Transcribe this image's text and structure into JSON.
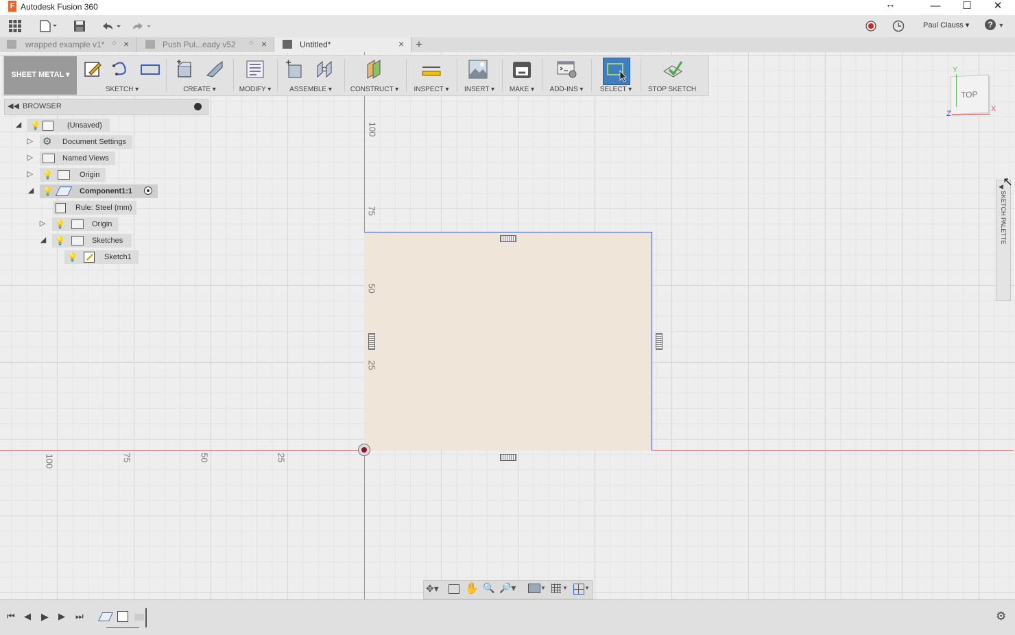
{
  "app": {
    "title": "Autodesk Fusion 360",
    "logo_letter": "F",
    "brand_color": "#f26122"
  },
  "window": {
    "minimize": "—",
    "maximize": "☐",
    "close": "✕",
    "resize_cursor": "↔"
  },
  "qat": {
    "user": "Paul Clauss ▾",
    "help": "?"
  },
  "tabs": [
    {
      "label": "wrapped example v1*",
      "active": false
    },
    {
      "label": "Push Pul...eady v52",
      "active": false
    },
    {
      "label": "Untitled*",
      "active": true
    }
  ],
  "toolbar": {
    "workspace": "SHEET METAL ▾",
    "groups": [
      {
        "label": "SKETCH ▾"
      },
      {
        "label": "CREATE ▾"
      },
      {
        "label": "MODIFY ▾"
      },
      {
        "label": "ASSEMBLE ▾"
      },
      {
        "label": "CONSTRUCT ▾"
      },
      {
        "label": "INSPECT ▾"
      },
      {
        "label": "INSERT ▾"
      },
      {
        "label": "MAKE ▾"
      },
      {
        "label": "ADD-INS ▾"
      },
      {
        "label": "SELECT ▾"
      },
      {
        "label": "STOP SKETCH"
      }
    ]
  },
  "browser": {
    "title": "BROWSER",
    "nodes": [
      {
        "label": "(Unsaved)"
      },
      {
        "label": "Document Settings"
      },
      {
        "label": "Named Views"
      },
      {
        "label": "Origin"
      },
      {
        "label": "Component1:1"
      },
      {
        "label": "Rule: Steel (mm)"
      },
      {
        "label": "Origin"
      },
      {
        "label": "Sketches"
      },
      {
        "label": "Sketch1"
      }
    ]
  },
  "viewcube": {
    "face": "TOP",
    "axis_x": "X",
    "axis_y": "Y",
    "axis_z": "Z"
  },
  "palette": {
    "label": "SKETCH PALETTE"
  },
  "rulers": {
    "vertical": [
      "100",
      "75",
      "50",
      "25"
    ],
    "horizontal": [
      "100",
      "75",
      "50",
      "25"
    ]
  },
  "colors": {
    "x_axis": "#d96060",
    "y_axis": "#5cc05c",
    "sketch_fill": "#efe5d8",
    "sketch_edge": "#3a55d0"
  }
}
